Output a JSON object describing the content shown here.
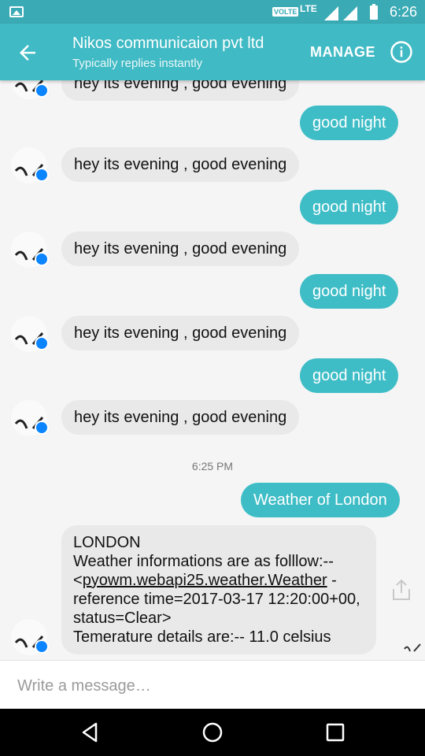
{
  "status_bar": {
    "volte": "VOLTE",
    "network": "LTE",
    "time": "6:26"
  },
  "header": {
    "title": "Nikos communicaion pvt ltd",
    "subtitle": "Typically replies instantly",
    "manage_label": "MANAGE",
    "back_icon": "arrow-left-icon",
    "info_icon": "info-icon"
  },
  "messages": [
    {
      "from": "them",
      "text": "hey its evening , good evening"
    },
    {
      "from": "me",
      "text": "good night"
    },
    {
      "from": "them",
      "text": "hey its evening , good evening"
    },
    {
      "from": "me",
      "text": "good night"
    },
    {
      "from": "them",
      "text": "hey its evening , good evening"
    },
    {
      "from": "me",
      "text": "good night"
    },
    {
      "from": "them",
      "text": "hey its evening , good evening"
    },
    {
      "from": "me",
      "text": "good night"
    },
    {
      "from": "them",
      "text": "hey its evening , good evening"
    }
  ],
  "timestamp": "6:25 PM",
  "weather_request": "Weather of London",
  "weather_reply": {
    "line1": "LONDON",
    "line2": "Weather informations are as folllow:--",
    "line3_prefix": "<",
    "line3_link": "pyowm.webapi25.weather.Weather",
    "line3_suffix": " -",
    "line4": "reference time=2017-03-17 12:20:00+00,",
    "line5": "status=Clear>",
    "line6": "Temerature details are:--   11.0 celsius"
  },
  "composer": {
    "placeholder": "Write a message…"
  },
  "colors": {
    "header": "#40bac4",
    "status_bar": "#3aaab4",
    "outgoing_bubble": "#3ebdc6",
    "incoming_bubble": "#e9e9e9",
    "messenger_badge": "#0a84ff"
  }
}
